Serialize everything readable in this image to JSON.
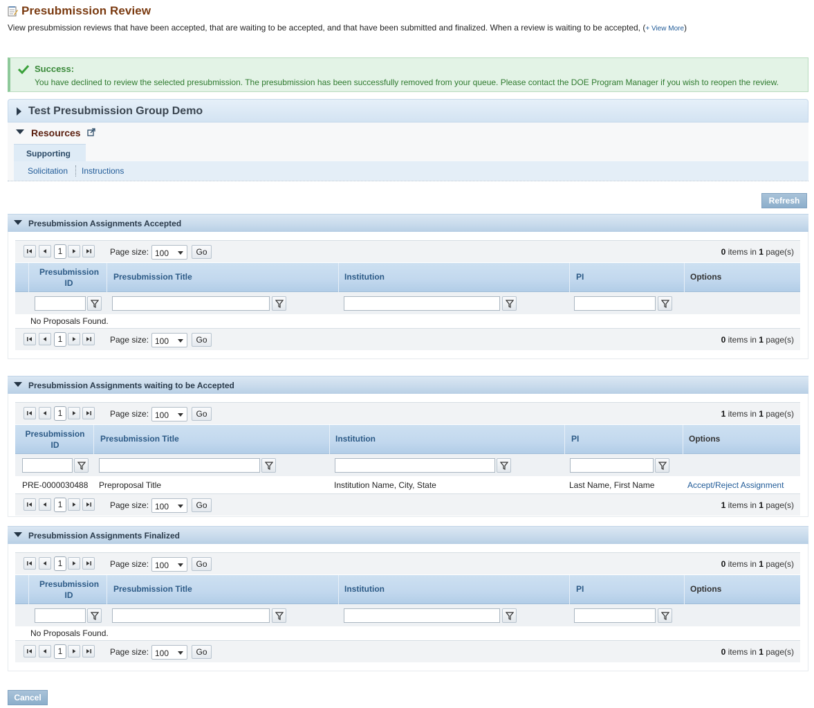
{
  "header": {
    "title": "Presubmission Review",
    "description": "View presubmission reviews that have been accepted, that are waiting to be accepted, and that have been submitted and finalized. When a review is waiting to be accepted,",
    "view_more": "+ View More"
  },
  "success": {
    "title": "Success:",
    "message": "You have declined to review the selected presubmission. The presubmission has been successfully removed from your queue. Please contact the DOE Program Manager if you wish to reopen the review."
  },
  "group": {
    "title": "Test Presubmission Group Demo",
    "resources_label": "Resources",
    "tab_label": "Supporting",
    "links": [
      "Solicitation",
      "Instructions"
    ]
  },
  "buttons": {
    "refresh": "Refresh",
    "cancel": "Cancel"
  },
  "pager_common": {
    "page_size_label": "Page size:",
    "page_size_value": "100",
    "go": "Go",
    "current_page": "1",
    "items_mid": "items in",
    "pages_suffix": "page(s)"
  },
  "columns": {
    "id": "Presubmission ID",
    "title": "Presubmission Title",
    "institution": "Institution",
    "pi": "PI",
    "options": "Options"
  },
  "sections": [
    {
      "title": "Presubmission Assignments Accepted",
      "items_count": "0",
      "page_count": "1",
      "empty_message": "No Proposals Found."
    },
    {
      "title": "Presubmission Assignments waiting to be Accepted",
      "items_count": "1",
      "page_count": "1",
      "rows": [
        {
          "id": "PRE-0000030488",
          "title": "Preproposal Title",
          "institution": "Institution Name, City, State",
          "pi": "Last Name, First Name",
          "option": "Accept/Reject Assignment"
        }
      ]
    },
    {
      "title": "Presubmission Assignments Finalized",
      "items_count": "0",
      "page_count": "1",
      "empty_message": "No Proposals Found."
    }
  ],
  "colors": {
    "title_brown": "#7a3a10",
    "success_green": "#3a8a3a",
    "link_blue": "#1f5a97",
    "header_blue": "#c2d8ee"
  }
}
